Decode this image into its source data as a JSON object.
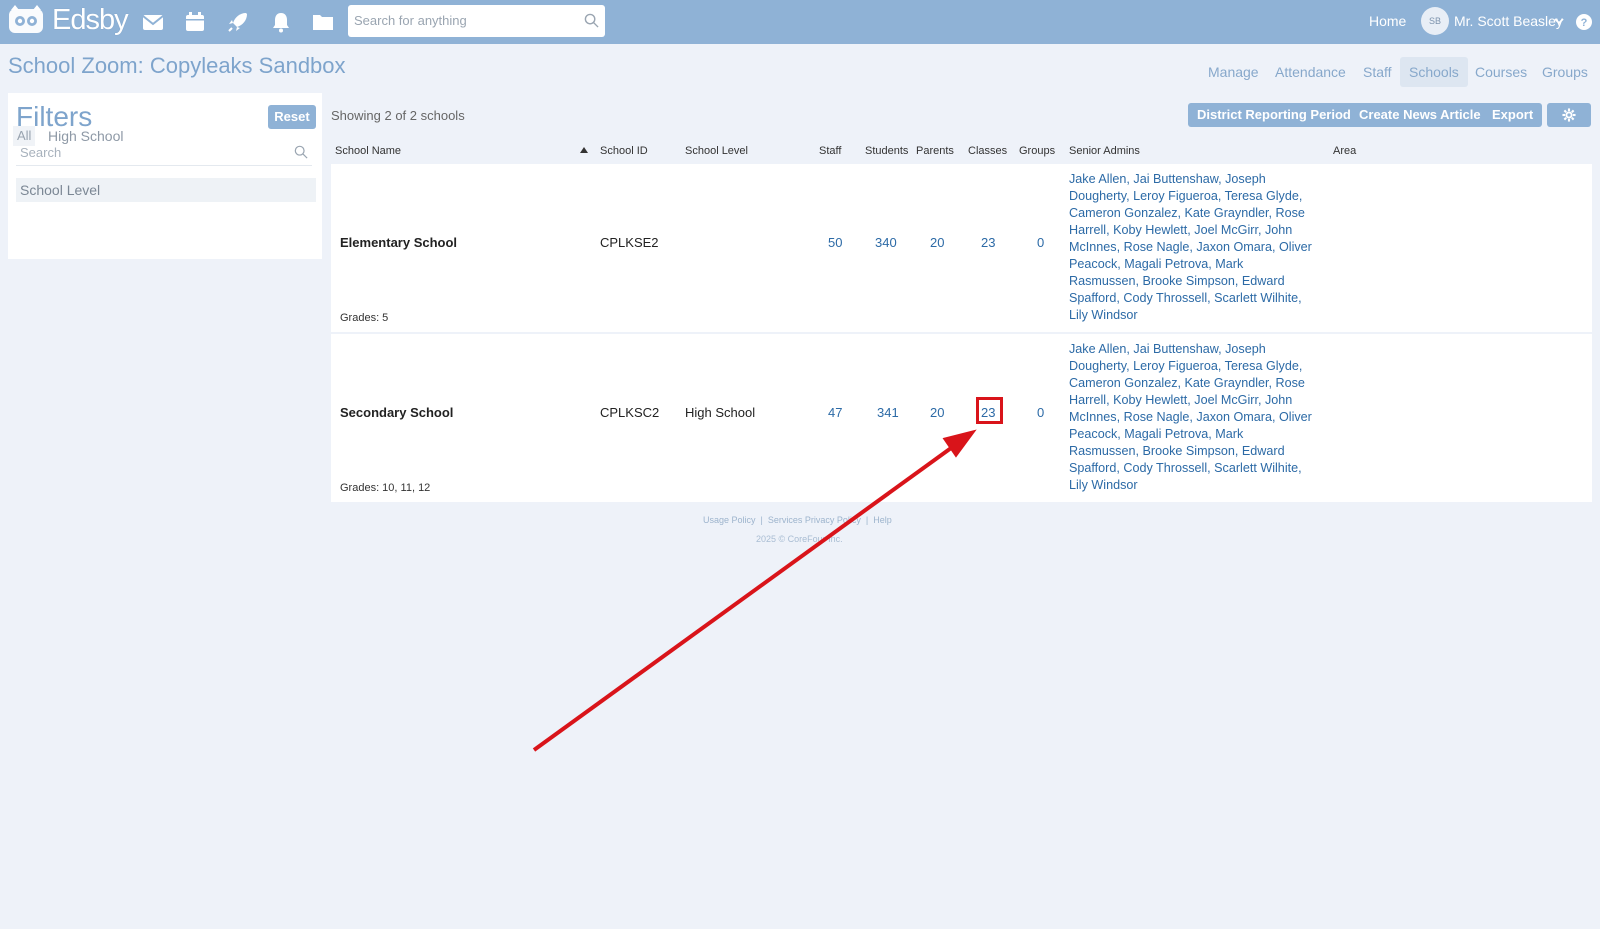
{
  "app": {
    "logo_text": "Edsby",
    "search_placeholder": "Search for anything",
    "home_label": "Home",
    "user_initials": "SB",
    "user_name": "Mr. Scott Beasley"
  },
  "page": {
    "title": "School Zoom: Copyleaks Sandbox",
    "nav_tabs": [
      "Manage",
      "Attendance",
      "Staff",
      "Schools",
      "Courses",
      "Groups"
    ],
    "active_tab": "Schools"
  },
  "filters": {
    "title": "Filters",
    "reset_label": "Reset",
    "search_placeholder": "Search",
    "group_label": "School Level",
    "chip_all": "All",
    "chip_option": "High School"
  },
  "toolbar": {
    "showing_text": "Showing 2 of 2 schools",
    "buttons": [
      "District Reporting Period",
      "Create News Article",
      "Export"
    ]
  },
  "table": {
    "headers": [
      "School Name",
      "School ID",
      "School Level",
      "Staff",
      "Students",
      "Parents",
      "Classes",
      "Groups",
      "Senior Admins",
      "Area"
    ],
    "rows": [
      {
        "name": "Elementary School",
        "id": "CPLKSE2",
        "level": "",
        "staff": "50",
        "students": "340",
        "parents": "20",
        "classes": "23",
        "groups": "0",
        "grades": "Grades: 5",
        "admins": "Jake Allen, Jai Buttenshaw, Joseph Dougherty, Leroy Figueroa, Teresa Glyde, Cameron Gonzalez, Kate Grayndler, Rose Harrell, Koby Hewlett, Joel McGirr, John McInnes, Rose Nagle, Jaxon Omara, Oliver Peacock, Magali Petrova, Mark Rasmussen, Brooke Simpson, Edward Spafford, Cody Throssell, Scarlett Wilhite, Lily Windsor"
      },
      {
        "name": "Secondary School",
        "id": "CPLKSC2",
        "level": "High School",
        "staff": "47",
        "students": "341",
        "parents": "20",
        "classes": "23",
        "groups": "0",
        "grades": "Grades: 10, 11, 12",
        "admins": "Jake Allen, Jai Buttenshaw, Joseph Dougherty, Leroy Figueroa, Teresa Glyde, Cameron Gonzalez, Kate Grayndler, Rose Harrell, Koby Hewlett, Joel McGirr, John McInnes, Rose Nagle, Jaxon Omara, Oliver Peacock, Magali Petrova, Mark Rasmussen, Brooke Simpson, Edward Spafford, Cody Throssell, Scarlett Wilhite, Lily Windsor"
      }
    ]
  },
  "footer": {
    "links": [
      "Usage Policy",
      "Services Privacy Policy",
      "Help"
    ],
    "copyright": "2025 © CoreFour Inc."
  },
  "colors": {
    "topbar": "#8fb2d6",
    "accent_text": "#7ea4cc",
    "link": "#2c6aa6",
    "annotation": "#d9141a"
  },
  "icons": [
    "owl-logo-icon",
    "mail-icon",
    "calendar-icon",
    "rocket-icon",
    "bell-icon",
    "folder-icon",
    "search-icon",
    "chevron-down-icon",
    "help-icon",
    "gear-icon",
    "sort-up-icon"
  ]
}
